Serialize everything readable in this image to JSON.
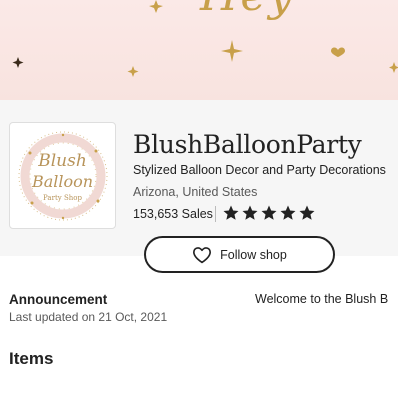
{
  "banner": {
    "script_text": "Hey"
  },
  "logo": {
    "line1": "Blush",
    "line2": "Balloon",
    "line3": "Party Shop"
  },
  "shop": {
    "name": "BlushBalloonParty",
    "title": "Stylized Balloon Decor and Party Decorations",
    "location": "Arizona, United States",
    "sales": "153,653 Sales",
    "rating": 5,
    "follow_label": "Follow shop"
  },
  "announcement": {
    "title": "Announcement",
    "updated": "Last updated on 21 Oct, 2021",
    "text": "Welcome to the Blush B"
  },
  "items": {
    "heading": "Items"
  },
  "icons": {
    "rating": "star-icon",
    "follow": "heart-icon"
  },
  "colors": {
    "gold": "#c8a04a",
    "banner_pink": "#fbe9e7",
    "text": "#222222"
  }
}
